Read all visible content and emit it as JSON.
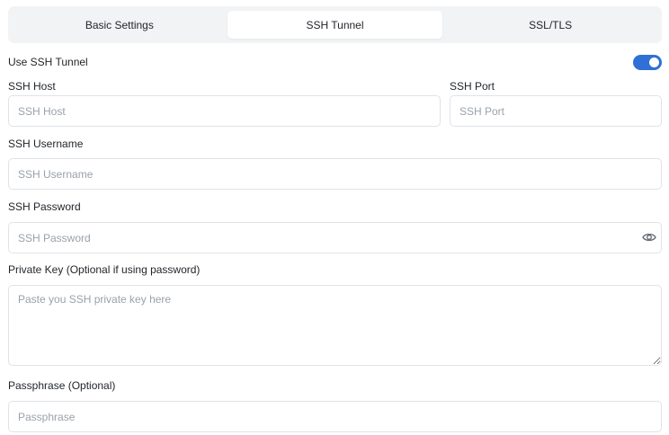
{
  "tabs": [
    {
      "label": "Basic Settings",
      "active": false
    },
    {
      "label": "SSH Tunnel",
      "active": true
    },
    {
      "label": "SSL/TLS",
      "active": false
    }
  ],
  "use_ssh_tunnel": {
    "label": "Use SSH Tunnel",
    "enabled": true,
    "accent": "#2f6fd6"
  },
  "ssh_host": {
    "label": "SSH Host",
    "placeholder": "SSH Host",
    "value": ""
  },
  "ssh_port": {
    "label": "SSH Port",
    "placeholder": "SSH Port",
    "value": ""
  },
  "ssh_username": {
    "label": "SSH Username",
    "placeholder": "SSH Username",
    "value": ""
  },
  "ssh_password": {
    "label": "SSH Password",
    "placeholder": "SSH Password",
    "value": "",
    "reveal_icon": "eye-icon"
  },
  "private_key": {
    "label": "Private Key (Optional if using password)",
    "placeholder": "Paste you SSH private key here",
    "value": ""
  },
  "passphrase": {
    "label": "Passphrase (Optional)",
    "placeholder": "Passphrase",
    "value": ""
  }
}
